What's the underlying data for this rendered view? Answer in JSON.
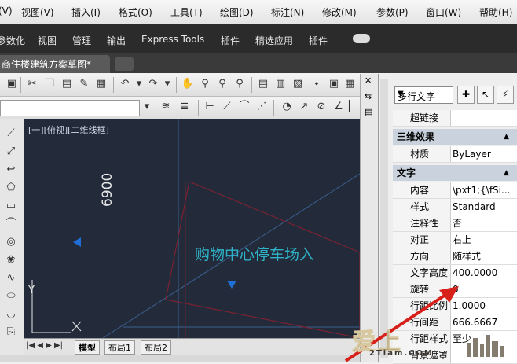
{
  "menu": [
    "(V)",
    "视图(V)",
    "插入(I)",
    "格式(O)",
    "工具(T)",
    "绘图(D)",
    "标注(N)",
    "修改(M)",
    "参数(P)",
    "窗口(W)",
    "帮助(H)"
  ],
  "ribbon_tabs": [
    "参数化",
    "视图",
    "管理",
    "输出",
    "Express Tools",
    "插件",
    "精选应用",
    "插件"
  ],
  "document_tab": "商住楼建筑方案草图*",
  "viewport_label": "[一][俯视][二维线框]",
  "drawing": {
    "dimension_text": "6900",
    "text_label": "购物中心停车场入",
    "axis_y": "Y"
  },
  "layout_tabs": [
    "模型",
    "布局1",
    "布局2"
  ],
  "properties": {
    "object_type": "多行文字",
    "rows_top": [
      {
        "key": "超链接",
        "value": ""
      }
    ],
    "section_3d": {
      "title": "三维效果",
      "rows": [
        {
          "key": "材质",
          "value": "ByLayer"
        }
      ]
    },
    "section_text": {
      "title": "文字",
      "rows": [
        {
          "key": "内容",
          "value": "\\pxt1;{\\fSi..."
        },
        {
          "key": "样式",
          "value": "Standard"
        },
        {
          "key": "注释性",
          "value": "否"
        },
        {
          "key": "对正",
          "value": "右上"
        },
        {
          "key": "方向",
          "value": "随样式"
        },
        {
          "key": "文字高度",
          "value": "400.0000"
        },
        {
          "key": "旋转",
          "value": "0"
        },
        {
          "key": "行距比例",
          "value": "1.0000"
        },
        {
          "key": "行间距",
          "value": "666.6667"
        },
        {
          "key": "行距样式",
          "value": "至少"
        },
        {
          "key": "背景遮罩",
          "value": ""
        }
      ]
    }
  },
  "watermark": {
    "main": "爱上",
    "sub": "2Tiam.COM"
  },
  "colors": {
    "canvas": "#232b3a",
    "accent_cyan": "#2fb3c8",
    "red_frame": "#7a2233",
    "arrow_red": "#d8201a",
    "grip_blue": "#1f6fd6"
  },
  "icons": [
    "cut-icon",
    "copy-icon",
    "paste-icon",
    "undo-icon",
    "redo-icon",
    "pan-icon",
    "zoom-icon",
    "properties-icon",
    "layer-icon",
    "line-icon",
    "polyline-icon",
    "circle-icon",
    "arc-icon",
    "rectangle-icon",
    "quick-select-icon",
    "select-objects-icon",
    "toggle-pickadd-icon"
  ]
}
